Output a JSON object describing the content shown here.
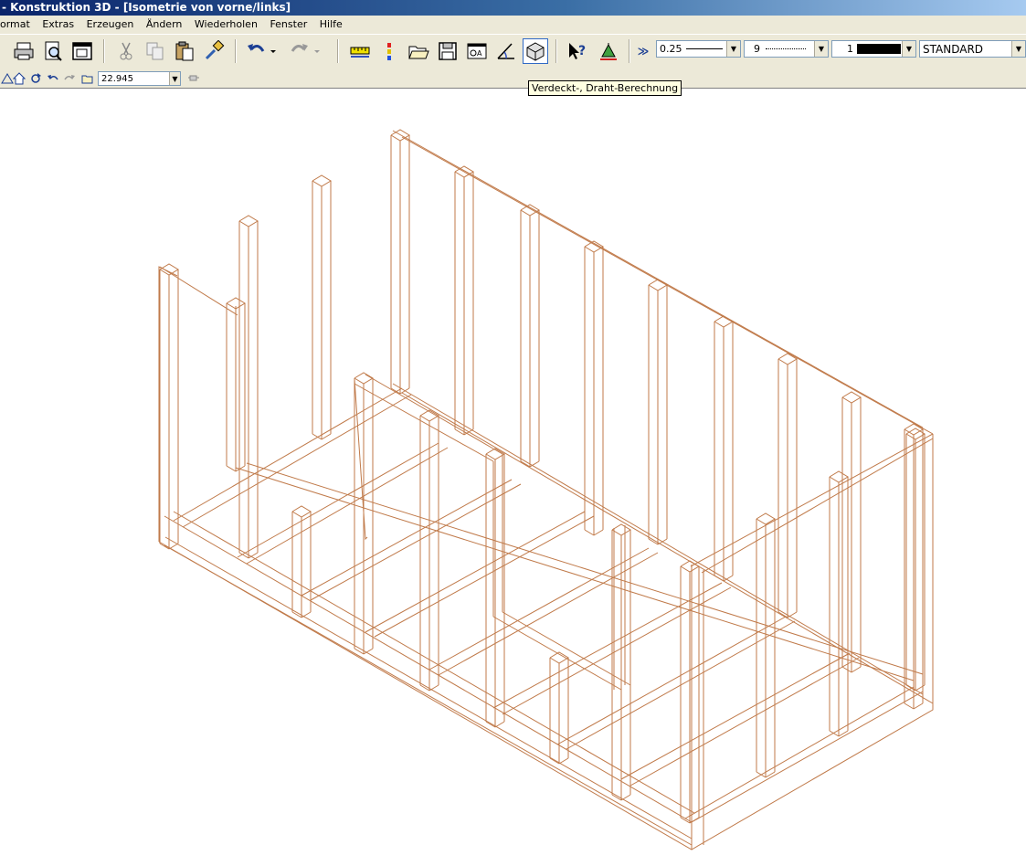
{
  "window": {
    "title": "- Konstruktion 3D - [Isometrie von vorne/links]"
  },
  "menu": {
    "items": [
      "ormat",
      "Extras",
      "Erzeugen",
      "Ändern",
      "Wiederholen",
      "Fenster",
      "Hilfe"
    ]
  },
  "toolbar": {
    "buttons": [
      {
        "name": "print-icon"
      },
      {
        "name": "print-preview-icon"
      },
      {
        "name": "window-icon"
      },
      {
        "name": "cut-icon"
      },
      {
        "name": "copy-icon"
      },
      {
        "name": "paste-icon"
      },
      {
        "name": "format-brush-icon"
      },
      {
        "name": "undo-icon"
      },
      {
        "name": "redo-icon"
      },
      {
        "name": "ruler-icon"
      },
      {
        "name": "layer-icon"
      },
      {
        "name": "open-folder-icon"
      },
      {
        "name": "save-icon"
      },
      {
        "name": "view-icon"
      },
      {
        "name": "angle-icon"
      },
      {
        "name": "hidden-line-icon"
      },
      {
        "name": "help-arrow-icon"
      },
      {
        "name": "measure-icon"
      }
    ],
    "chevron": "≫",
    "pen_thickness": "0.25",
    "line_type": "9",
    "color_index": "1",
    "style": "STANDARD"
  },
  "toolbar2": {
    "coordinate_value": "22.945"
  },
  "tooltip": {
    "text": "Verdeckt-, Draht-Berechnung"
  },
  "drawing": {
    "line_color": "#c07a4a"
  }
}
